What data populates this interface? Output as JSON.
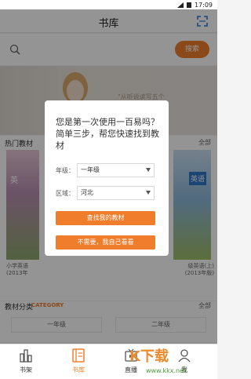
{
  "statusbar": {
    "time": "17:09"
  },
  "header": {
    "title": "书库"
  },
  "search": {
    "button": "搜索"
  },
  "banner": {
    "text": "\"从听说读写五个"
  },
  "hot": {
    "title": "热门教材",
    "more": "全部",
    "book_left": {
      "cover": "英",
      "caption1": "小学英语",
      "caption2": "(2013年"
    },
    "book_right": {
      "cover": "英语",
      "caption1": "级英语(上)",
      "caption2": "(2013年版)"
    }
  },
  "category": {
    "title": "教材分类",
    "title_en": "CATEGORY",
    "more": "全部",
    "grades": [
      "一年级",
      "二年级"
    ]
  },
  "dialog": {
    "title": "您是第一次使用一百易吗？简单三步，帮您快速找到教材",
    "grade_label": "年级：",
    "grade_value": "一年级",
    "region_label": "区域：",
    "region_value": "河北",
    "find_button": "查找我的教材",
    "skip_button": "不需要，我自己看看"
  },
  "tabs": [
    {
      "label": "书架",
      "icon": "bar-chart-icon"
    },
    {
      "label": "书库",
      "icon": "book-list-icon"
    },
    {
      "label": "直播",
      "icon": "tv-icon"
    },
    {
      "label": "我",
      "icon": "user-icon"
    }
  ],
  "watermark": {
    "text": "K下载",
    "url": "www.kkx.net"
  },
  "colors": {
    "accent": "#f07d2c"
  }
}
